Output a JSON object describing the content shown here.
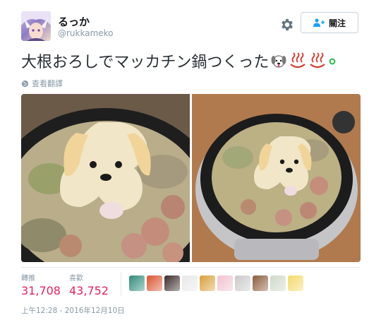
{
  "user": {
    "display_name": "るっか",
    "handle": "@rukkameko"
  },
  "header": {
    "settings_icon": "gear-icon",
    "follow_label": "關注",
    "follow_icon": "person-add-icon"
  },
  "tweet": {
    "text": "大根おろしでマッカチン鍋つくった",
    "emoji": [
      "dog-face-emoji",
      "hot-springs-emoji",
      "hot-springs-emoji"
    ],
    "translate_label": "查看翻譯",
    "translate_icon": "globe-icon"
  },
  "media": {
    "photos": [
      {
        "subject": "grated-daikon-dog-in-hotpot-closeup"
      },
      {
        "subject": "grated-daikon-dog-in-electric-pot"
      }
    ]
  },
  "stats": {
    "retweets_label": "轉推",
    "retweets_value": "31,708",
    "likes_label": "喜歡",
    "likes_value": "43,752"
  },
  "likers": {
    "count_shown": 10,
    "colors": [
      "#2e8b7a",
      "#d9542e",
      "#3b2a2a",
      "#e8e8e8",
      "#d9a03a",
      "#f2c1cf",
      "#c9c9c9",
      "#8a5a3a",
      "#cfd8c8",
      "#f4d96a"
    ]
  },
  "timestamp": "上午12:28 - 2016年12月10日",
  "colors": {
    "accent_pink": "#e0245e",
    "muted": "#8899a6",
    "text": "#14171a"
  }
}
